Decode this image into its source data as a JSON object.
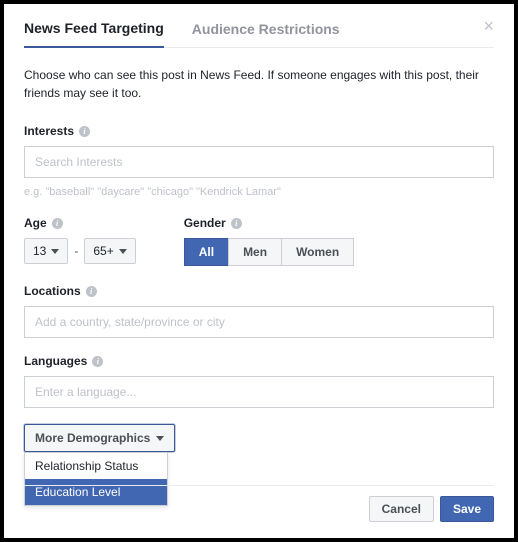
{
  "tabs": {
    "active": "News Feed Targeting",
    "other": "Audience Restrictions"
  },
  "description": "Choose who can see this post in News Feed. If someone engages with this post, their friends may see it too.",
  "interests": {
    "label": "Interests",
    "placeholder": "Search Interests",
    "hint": "e.g. \"baseball\" \"daycare\" \"chicago\" \"Kendrick Lamar\""
  },
  "age": {
    "label": "Age",
    "min": "13",
    "max": "65+"
  },
  "gender": {
    "label": "Gender",
    "options": [
      "All",
      "Men",
      "Women"
    ],
    "selected": "All"
  },
  "locations": {
    "label": "Locations",
    "placeholder": "Add a country, state/province or city"
  },
  "languages": {
    "label": "Languages",
    "placeholder": "Enter a language..."
  },
  "more": {
    "label": "More Demographics",
    "items": [
      "Relationship Status",
      "Education Level"
    ],
    "highlighted": "Education Level"
  },
  "footer": {
    "cancel": "Cancel",
    "save": "Save"
  }
}
